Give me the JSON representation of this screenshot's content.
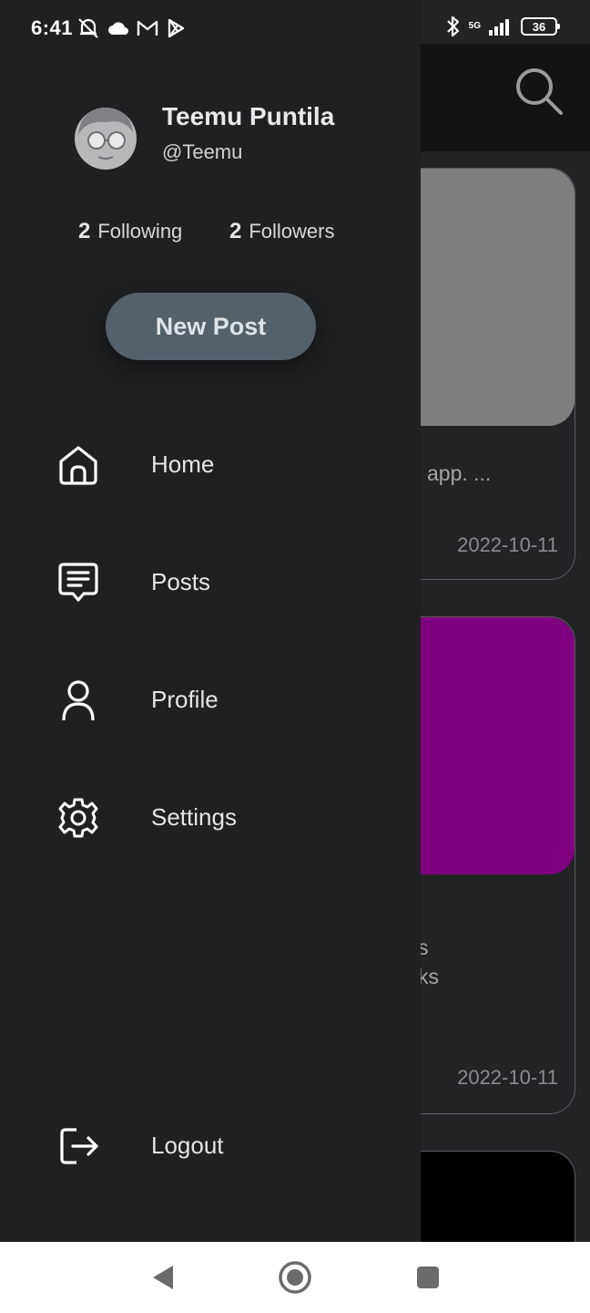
{
  "status_bar": {
    "time": "6:41",
    "network": "5G",
    "battery": "36"
  },
  "user": {
    "name": "Teemu Puntila",
    "handle": "@Teemu",
    "following_count": "2",
    "following_label": "Following",
    "followers_count": "2",
    "followers_label": "Followers"
  },
  "drawer": {
    "new_post_label": "New Post",
    "nav_items": [
      {
        "label": "Home",
        "icon": "home-icon"
      },
      {
        "label": "Posts",
        "icon": "posts-icon"
      },
      {
        "label": "Profile",
        "icon": "profile-icon"
      },
      {
        "label": "Settings",
        "icon": "settings-icon"
      }
    ],
    "logout_label": "Logout",
    "logout_icon": "logout-icon"
  },
  "feed": {
    "posts": [
      {
        "image_color": "#7f7f7f",
        "text_lines": [
          "app.  ..."
        ],
        "date": "2022-10-11"
      },
      {
        "image_color": "#800080",
        "text_lines": [
          "s",
          "ks"
        ],
        "date": "2022-10-11"
      },
      {
        "image_color": "#000000",
        "text_lines": [],
        "date": ""
      }
    ]
  },
  "colors": {
    "drawer_bg": "#1f2022",
    "button_bg": "#54616b",
    "text_primary": "#e4e5e6"
  }
}
